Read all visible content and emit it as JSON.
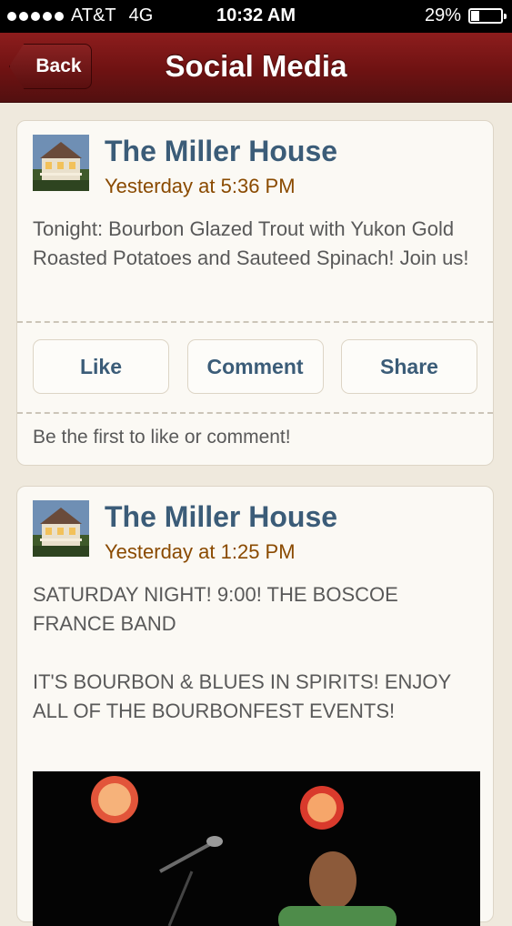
{
  "status_bar": {
    "carrier": "AT&T",
    "network": "4G",
    "time": "10:32 AM",
    "battery": "29%",
    "battery_level": 0.29
  },
  "nav": {
    "back_label": "Back",
    "title": "Social Media"
  },
  "posts": [
    {
      "name": "The Miller House",
      "time": "Yesterday at 5:36 PM",
      "text": "Tonight:  Bourbon Glazed Trout with Yukon Gold Roasted Potatoes and Sauteed Spinach!  Join us!",
      "actions": {
        "like": "Like",
        "comment": "Comment",
        "share": "Share"
      },
      "engagement": "Be the first to like or comment!"
    },
    {
      "name": "The Miller House",
      "time": "Yesterday at 1:25 PM",
      "text": "SATURDAY NIGHT! 9:00! THE BOSCOE FRANCE BAND\n\n IT'S BOURBON & BLUES IN SPIRITS! ENJOY ALL OF THE BOURBONFEST EVENTS!"
    }
  ]
}
